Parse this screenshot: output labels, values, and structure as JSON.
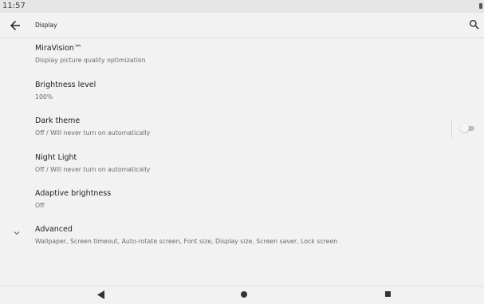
{
  "status_bar": {
    "time": "11:57",
    "battery_icon": "battery-icon"
  },
  "app_bar": {
    "back_icon": "arrow-back-icon",
    "title": "Display",
    "search_icon": "search-icon"
  },
  "preferences": [
    {
      "title": "MiraVision™",
      "summary": "Display picture quality optimization"
    },
    {
      "title": "Brightness level",
      "summary": "100%"
    },
    {
      "title": "Dark theme",
      "summary": "Off / Will never turn on automatically",
      "toggle": false
    },
    {
      "title": "Night Light",
      "summary": "Off / Will never turn on automatically"
    },
    {
      "title": "Adaptive brightness",
      "summary": "Off"
    },
    {
      "title": "Advanced",
      "summary": "Wallpaper, Screen timeout, Auto-rotate screen, Font size, Display size, Screen saver, Lock screen",
      "icon": "chevron-down-icon"
    }
  ],
  "nav_bar": {
    "back_icon": "nav-back-triangle-icon",
    "home_icon": "nav-home-circle-icon",
    "recents_icon": "nav-recents-square-icon"
  },
  "colors": {
    "background": "#f2f2f2",
    "text_primary": "#202124",
    "text_secondary": "#6b6b6b",
    "toggle_track_off": "#bdbdbd"
  }
}
